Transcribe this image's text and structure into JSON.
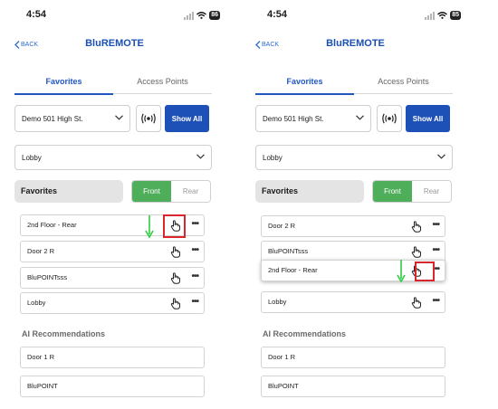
{
  "colors": {
    "accent": "#1e51b8",
    "toggle_on": "#4fae5a",
    "highlight": "#d9252c",
    "arrow": "#2ecc40"
  },
  "screens": {
    "left": {
      "status": {
        "time": "4:54",
        "battery": "86"
      },
      "header": {
        "back_label": "BACK",
        "title": "BluREMOTE"
      },
      "tabs": [
        "Favorites",
        "Access Points"
      ],
      "location": "Demo 501 High St.",
      "show_all": "Show All",
      "area": "Lobby",
      "favorites": {
        "title": "Favorites",
        "toggle": [
          "Front",
          "Rear"
        ],
        "selected": "Front"
      },
      "favorite_items": [
        {
          "label": "2nd Floor - Rear"
        },
        {
          "label": "Door 2 R"
        },
        {
          "label": "BluPOINTsss"
        },
        {
          "label": "Lobby"
        }
      ],
      "ai_title": "AI Recommendations",
      "ai_items": [
        {
          "label": "Door 1 R"
        },
        {
          "label": "BluPOINT"
        }
      ]
    },
    "right": {
      "status": {
        "time": "4:54",
        "battery": "85"
      },
      "header": {
        "back_label": "BACK",
        "title": "BluREMOTE"
      },
      "tabs": [
        "Favorites",
        "Access Points"
      ],
      "location": "Demo 501 High St.",
      "show_all": "Show All",
      "area": "Lobby",
      "favorites": {
        "title": "Favorites",
        "toggle": [
          "Front",
          "Rear"
        ],
        "selected": "Front"
      },
      "favorite_items": [
        {
          "label": "Door 2 R"
        },
        {
          "label": "BluPOINTsss"
        },
        {
          "label": "2nd Floor - Rear"
        },
        {
          "label": "Lobby"
        }
      ],
      "ai_title": "AI Recommendations",
      "ai_items": [
        {
          "label": "Door 1 R"
        },
        {
          "label": "BluPOINT"
        }
      ]
    }
  }
}
